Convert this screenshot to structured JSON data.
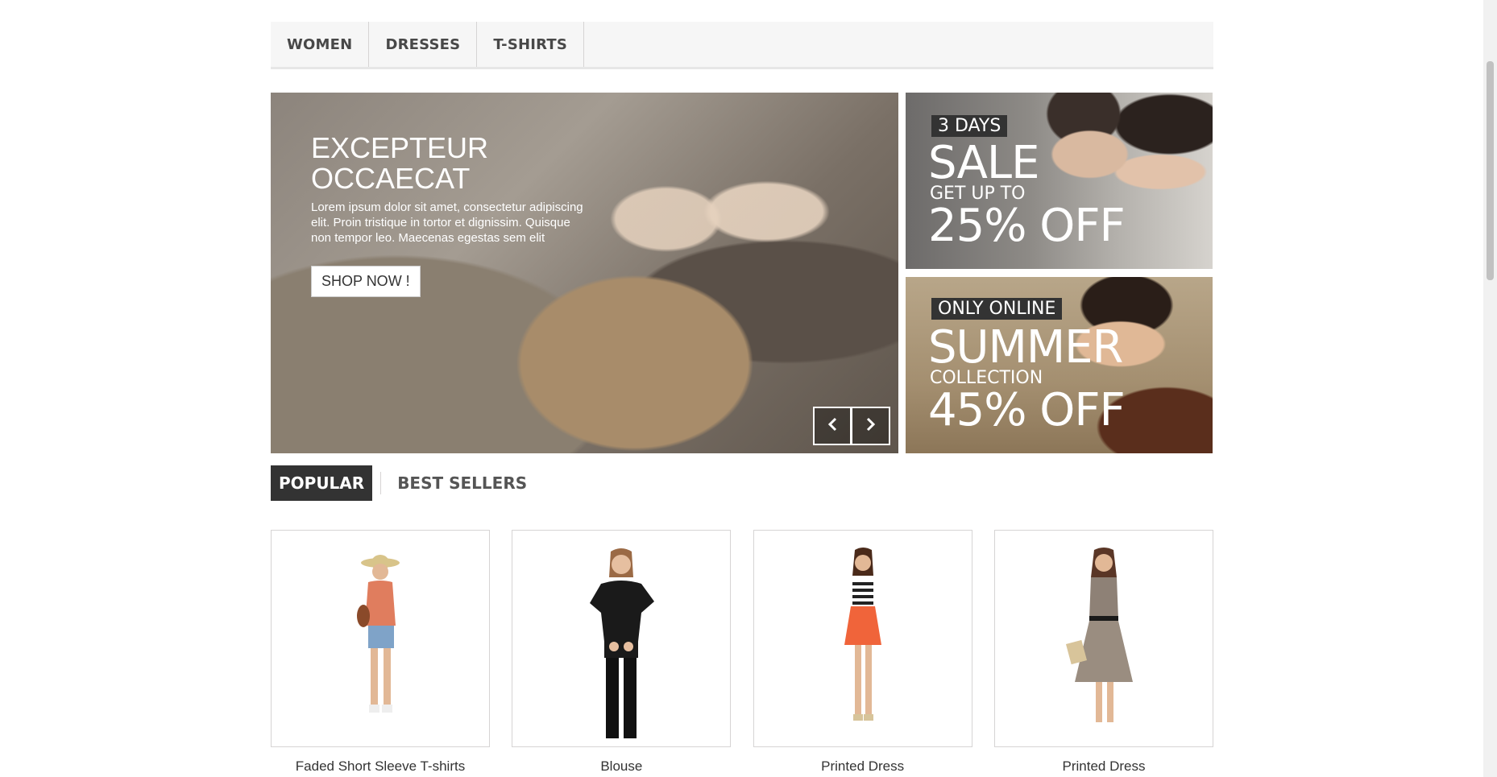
{
  "nav": {
    "items": [
      {
        "label": "WOMEN"
      },
      {
        "label": "DRESSES"
      },
      {
        "label": "T-SHIRTS"
      }
    ]
  },
  "slider": {
    "title": "EXCEPTEUR OCCAECAT",
    "text": "Lorem ipsum dolor sit amet, consectetur adipiscing elit. Proin tristique in tortor et dignissim. Quisque non tempor leo. Maecenas egestas sem elit",
    "button": "SHOP NOW !",
    "prev_icon": "chevron-left-icon",
    "next_icon": "chevron-right-icon"
  },
  "banners": [
    {
      "badge": "3 DAYS",
      "big": "SALE",
      "small": "GET UP TO",
      "pct": "25% OFF"
    },
    {
      "badge": "ONLY ONLINE",
      "big": "SUMMER",
      "small": "COLLECTION",
      "pct": "45% OFF"
    }
  ],
  "tabs": [
    {
      "label": "POPULAR",
      "active": true
    },
    {
      "label": "BEST SELLERS",
      "active": false
    }
  ],
  "products": [
    {
      "name": "Faded Short Sleeve T-shirts"
    },
    {
      "name": "Blouse"
    },
    {
      "name": "Printed Dress"
    },
    {
      "name": "Printed Dress"
    }
  ],
  "colors": {
    "nav_bg": "#f6f6f6",
    "tab_active_bg": "#333333",
    "border": "#d6d4d4"
  }
}
